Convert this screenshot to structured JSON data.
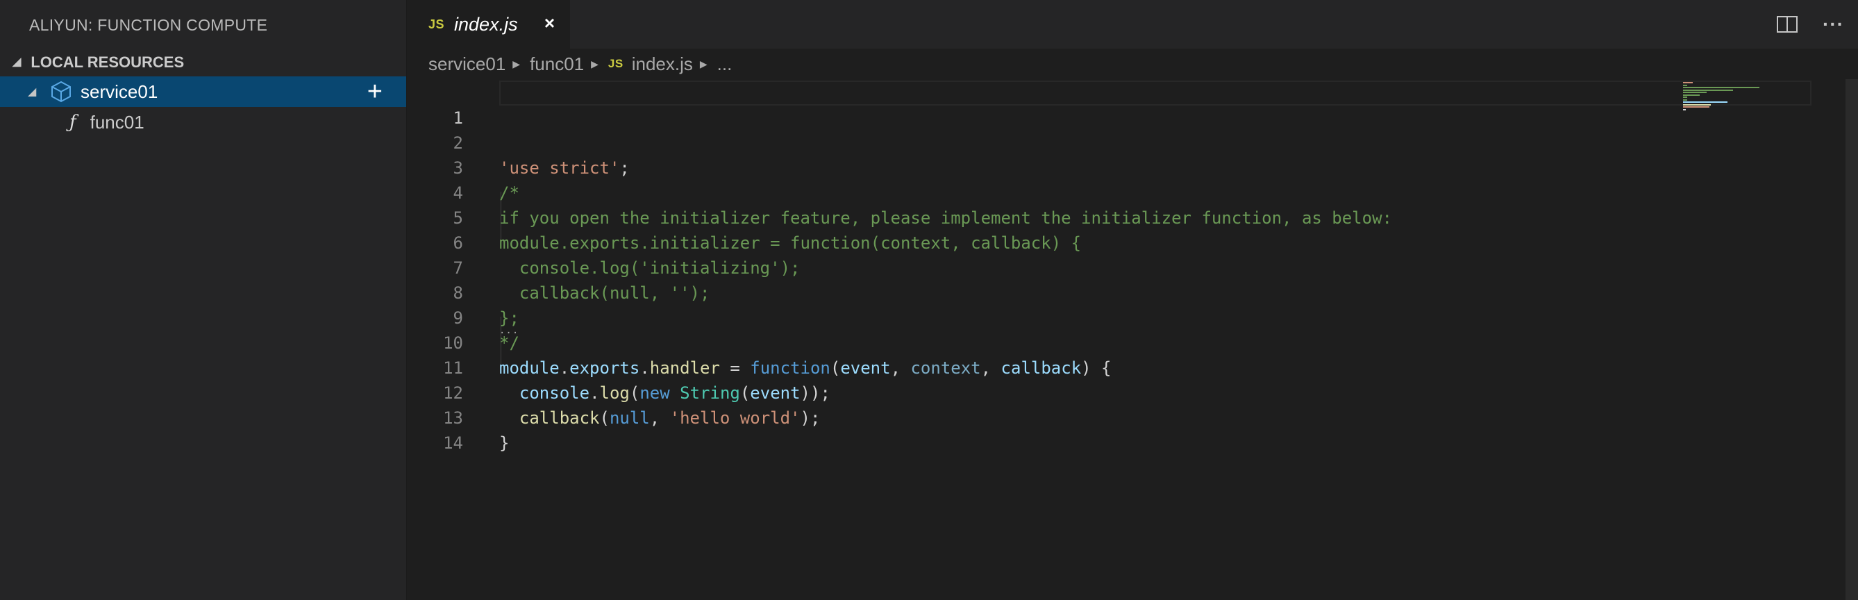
{
  "sidebar": {
    "title": "ALIYUN: FUNCTION COMPUTE",
    "section": "LOCAL RESOURCES",
    "tree": [
      {
        "label": "service01",
        "icon": "service-cube-icon",
        "selected": true
      },
      {
        "label": "func01",
        "icon": "function-icon"
      }
    ],
    "function_symbol": "ƒ",
    "add_symbol": "+"
  },
  "tabs": [
    {
      "badge": "JS",
      "label": "index.js",
      "close": "×"
    }
  ],
  "tab_actions": {
    "more": "···"
  },
  "breadcrumb": {
    "items": [
      "service01",
      "func01"
    ],
    "file_badge": "JS",
    "file": "index.js",
    "tail": "..."
  },
  "editor": {
    "line_numbers": [
      "1",
      "2",
      "3",
      "4",
      "5",
      "6",
      "7",
      "8",
      "9",
      "10",
      "11",
      "12",
      "13",
      "14"
    ],
    "active_line": 1
  },
  "colors": {
    "comment": "#6a9955",
    "string": "#ce9178",
    "keyword": "#569cd6",
    "function": "#dcdcaa",
    "variable": "#9cdcfe",
    "type": "#4ec9b0",
    "selection": "#094771"
  }
}
